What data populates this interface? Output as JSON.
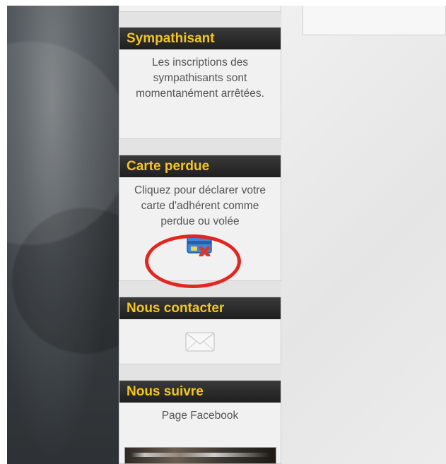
{
  "sidebar": {
    "sympathisant": {
      "title": "Sympathisant",
      "text": "Les inscriptions des sympathisants sont momentanément arrêtées."
    },
    "carte_perdue": {
      "title": "Carte perdue",
      "text": "Cliquez pour déclarer votre carte d'adhérent comme perdue ou volée",
      "icon": "lost-card-icon"
    },
    "nous_contacter": {
      "title": "Nous contacter",
      "icon": "envelope-icon"
    },
    "nous_suivre": {
      "title": "Nous suivre",
      "link_text": "Page Facebook"
    }
  },
  "colors": {
    "widget_title": "#f2c61f",
    "widget_header_bg": "#222222",
    "annotation_circle": "#e3261f"
  }
}
